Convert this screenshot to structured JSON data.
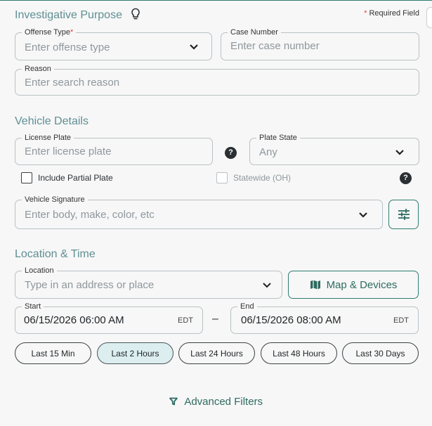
{
  "investigative_purpose": {
    "title": "Investigative Purpose",
    "icon": "lightbulb-icon",
    "required_note": "Required Field",
    "offense_type": {
      "label": "Offense Type",
      "required_mark": "*",
      "placeholder": "Enter offense type"
    },
    "case_number": {
      "label": "Case Number",
      "placeholder": "Enter case number"
    },
    "reason": {
      "label": "Reason",
      "placeholder": "Enter search reason"
    }
  },
  "vehicle_details": {
    "title": "Vehicle Details",
    "license_plate": {
      "label": "License Plate",
      "placeholder": "Enter license plate"
    },
    "plate_state": {
      "label": "Plate State",
      "value": "Any"
    },
    "include_partial_plate": {
      "label": "Include Partial Plate",
      "checked": false
    },
    "statewide": {
      "label": "Statewide (OH)",
      "checked": false,
      "disabled": true
    },
    "vehicle_signature": {
      "label": "Vehicle Signature",
      "placeholder": "Enter body, make, color, etc"
    },
    "help_glyph": "?"
  },
  "location_time": {
    "title": "Location & Time",
    "location": {
      "label": "Location",
      "placeholder": "Type in an address or place"
    },
    "map_button": "Map & Devices",
    "start": {
      "label": "Start",
      "value": "06/15/2026 06:00 AM",
      "tz": "EDT"
    },
    "range_separator": "–",
    "end": {
      "label": "End",
      "value": "06/15/2026 08:00 AM",
      "tz": "EDT"
    },
    "quick_ranges": [
      "Last 15 Min",
      "Last 2 Hours",
      "Last 24 Hours",
      "Last 48 Hours",
      "Last 30 Days"
    ],
    "active_range": "Last 2 Hours"
  },
  "advanced_filters": "Advanced Filters",
  "colors": {
    "accent": "#2e7d6f",
    "section_title": "#5f8f93",
    "required": "#e0443a",
    "chip_active_bg": "#dceef0"
  }
}
